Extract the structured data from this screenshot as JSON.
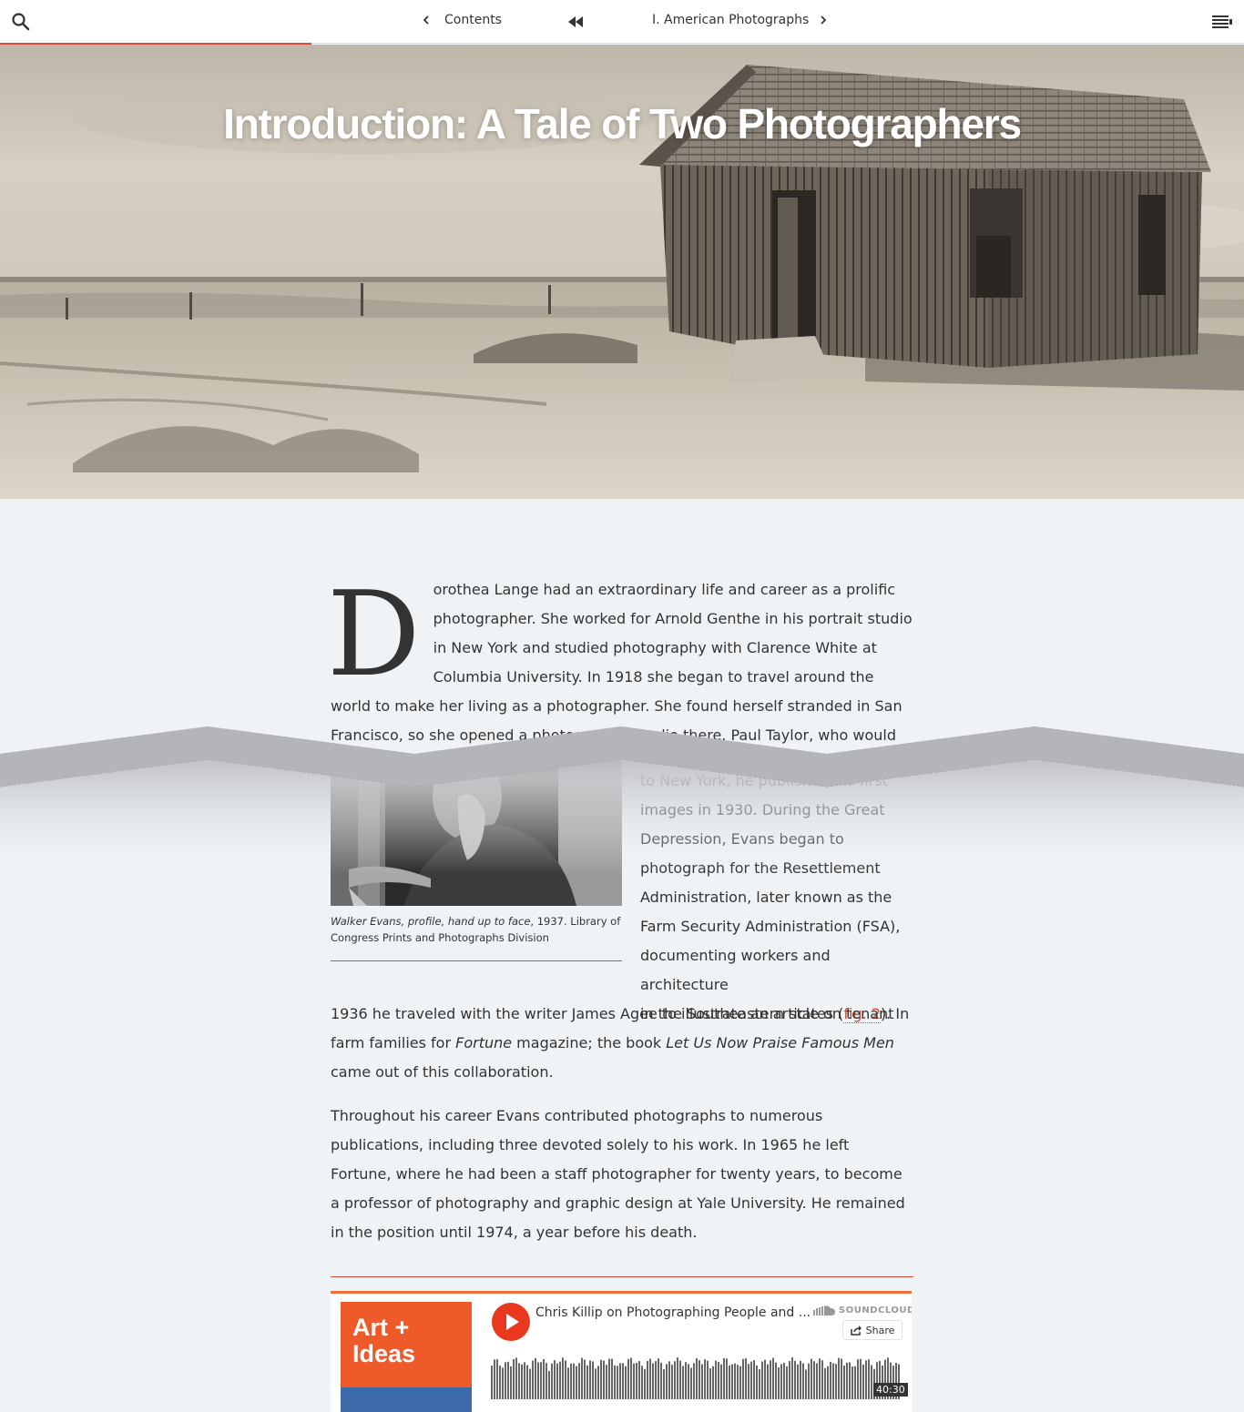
{
  "nav": {
    "prev_label": "Contents",
    "next_label": "I. American Photographs",
    "reading_progress": 0.25
  },
  "hero": {
    "title": "Introduction: A Tale of Two Photographers"
  },
  "article": {
    "dropcap": "D",
    "p1_text": "orothea Lange had an extraordinary life and career as a prolific photographer. She worked for Arnold Genthe in his portrait studio in New York and studied photography with Clarence White at Columbia University. In 1918 she began to travel around the world to make her living as a photographer. She found herself stranded in San Francisco, so she opened a photographic studio there. Paul Taylor, who would become her second husband,",
    "figure_caption_title": "Walker Evans, profile, hand up to face",
    "figure_caption_rest": ", 1937. Library of Congress Prints and Photographs Division",
    "col_lines": [
      "to New York, he published his first",
      "images in 1930. During the Great",
      "Depression, Evans began to",
      "photograph for the Resettlement",
      "Administration, later known as the",
      "Farm Security Administration (FSA),",
      "documenting workers and architecture"
    ],
    "col_last_pre": "in the Southeastern states (",
    "fig_link": "fig. 2",
    "col_last_post": "). In",
    "cont_pre": "1936 he traveled with the writer James Agee to illustrate an article on tenant farm families for ",
    "cont_em1": "Fortune",
    "cont_mid": " magazine; the book ",
    "cont_em2": "Let Us Now Praise Famous Men",
    "cont_post": " came out of this collaboration.",
    "p3": "Throughout his career Evans contributed photographs to numerous publications, including three devoted solely to his work. In 1965 he left Fortune, where he had been a staff photographer for twenty years, to become a professor of photography and graphic design at Yale University. He remained in the position until 1974, a year before his death."
  },
  "player": {
    "art_text_line1": "Art +",
    "art_text_line2": "Ideas",
    "track_title": "Chris Killip on Photographing People and ...",
    "brand": "SOUNDCLOUD",
    "share_label": "Share",
    "duration": "40:30"
  },
  "colors": {
    "accent": "#d84a3a",
    "soundcloud_orange": "#f26f3a",
    "play_red": "#e8391f",
    "page_bg": "#eff3f6"
  },
  "icons": [
    "search-icon",
    "chevron-left-icon",
    "rewind-to-start-icon",
    "chevron-right-icon",
    "toc-menu-icon",
    "play-icon",
    "soundcloud-logo-icon",
    "share-icon"
  ]
}
